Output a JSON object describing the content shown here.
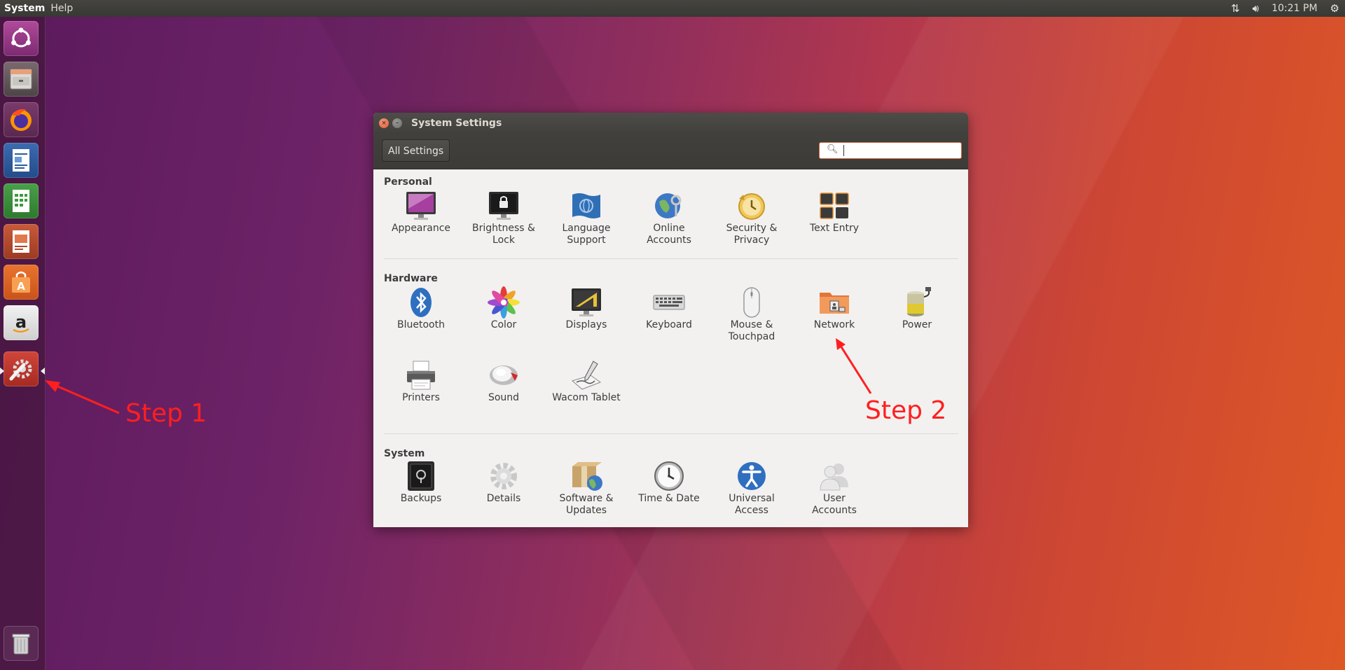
{
  "top_panel": {
    "menu": [
      "System",
      "Help"
    ],
    "time": "10:21 PM",
    "indicator_icons": [
      "network-transfer-icon",
      "volume-icon",
      "gear-icon"
    ]
  },
  "launcher": {
    "items": [
      {
        "name": "dash-home",
        "icon": "ubuntu-logo-icon"
      },
      {
        "name": "files",
        "icon": "file-cabinet-icon"
      },
      {
        "name": "firefox",
        "icon": "firefox-icon"
      },
      {
        "name": "libreoffice-writer",
        "icon": "writer-document-icon"
      },
      {
        "name": "libreoffice-calc",
        "icon": "calc-spreadsheet-icon"
      },
      {
        "name": "libreoffice-impress",
        "icon": "impress-presentation-icon"
      },
      {
        "name": "ubuntu-software",
        "icon": "shopping-bag-icon"
      },
      {
        "name": "amazon",
        "icon": "amazon-icon"
      },
      {
        "name": "system-settings",
        "icon": "settings-wrench-gear-icon",
        "active": true
      },
      {
        "name": "trash",
        "icon": "trash-icon"
      }
    ]
  },
  "window": {
    "title": "System Settings",
    "toolbar": {
      "all_settings_label": "All Settings",
      "search_value": "",
      "search_placeholder": ""
    },
    "sections": [
      {
        "title": "Personal",
        "items": [
          "Appearance",
          "Brightness &\nLock",
          "Language\nSupport",
          "Online\nAccounts",
          "Security &\nPrivacy",
          "Text Entry"
        ]
      },
      {
        "title": "Hardware",
        "items": [
          "Bluetooth",
          "Color",
          "Displays",
          "Keyboard",
          "Mouse &\nTouchpad",
          "Network",
          "Power",
          "Printers",
          "Sound",
          "Wacom Tablet"
        ]
      },
      {
        "title": "System",
        "items": [
          "Backups",
          "Details",
          "Software &\nUpdates",
          "Time & Date",
          "Universal\nAccess",
          "User\nAccounts"
        ]
      }
    ]
  },
  "annotations": {
    "step1": "Step 1",
    "step2": "Step 2",
    "color": "#ff1f1f"
  },
  "colors": {
    "accent": "#dd4814",
    "panel": "#3c3b37"
  }
}
